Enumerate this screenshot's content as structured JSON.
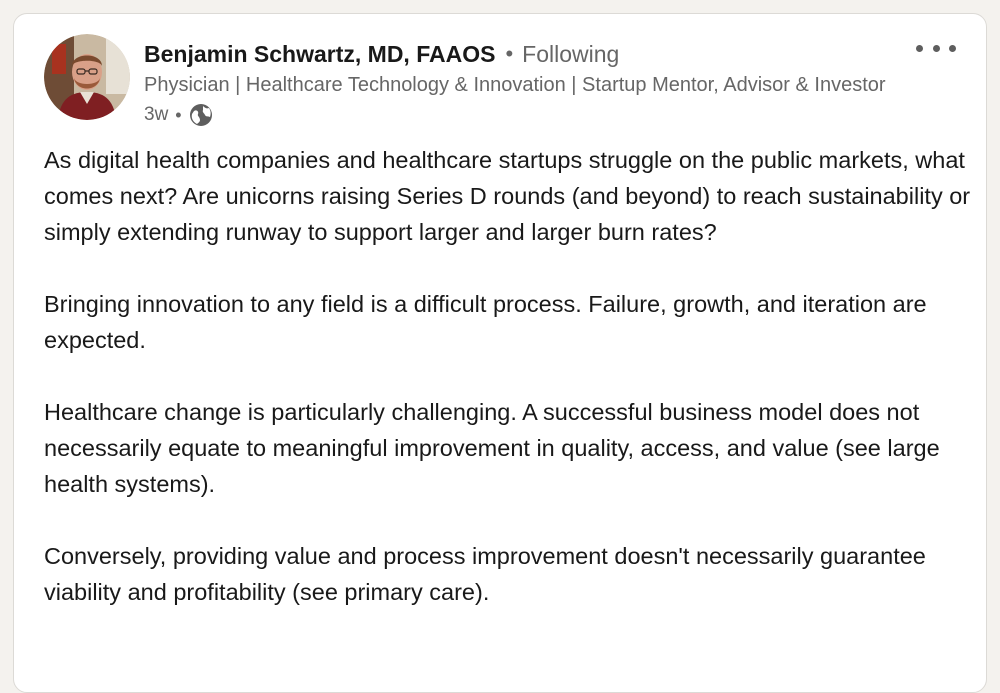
{
  "post": {
    "author": {
      "name": "Benjamin Schwartz, MD, FAAOS",
      "follow_status": "Following",
      "headline": "Physician | Healthcare Technology & Innovation | Startup Mentor, Advisor & Investor",
      "time_ago": "3w",
      "visibility_icon": "globe-icon"
    },
    "more_icon": "ellipsis-icon",
    "paragraphs": [
      "As digital health companies and healthcare startups struggle on the public markets, what comes next? Are unicorns raising Series D rounds (and beyond) to reach sustainability or simply extending runway to support larger and larger burn rates?",
      "Bringing innovation to any field is a difficult process. Failure, growth, and iteration are expected.",
      "Healthcare change is particularly challenging. A successful business model does not necessarily equate to meaningful improvement in quality, access, and value (see large health systems).",
      "Conversely, providing value and process improvement doesn't necessarily guarantee viability and profitability (see primary care)."
    ]
  },
  "colors": {
    "background": "#f4f2ee",
    "card": "#ffffff",
    "text_primary": "#191919",
    "text_secondary": "#666666"
  }
}
